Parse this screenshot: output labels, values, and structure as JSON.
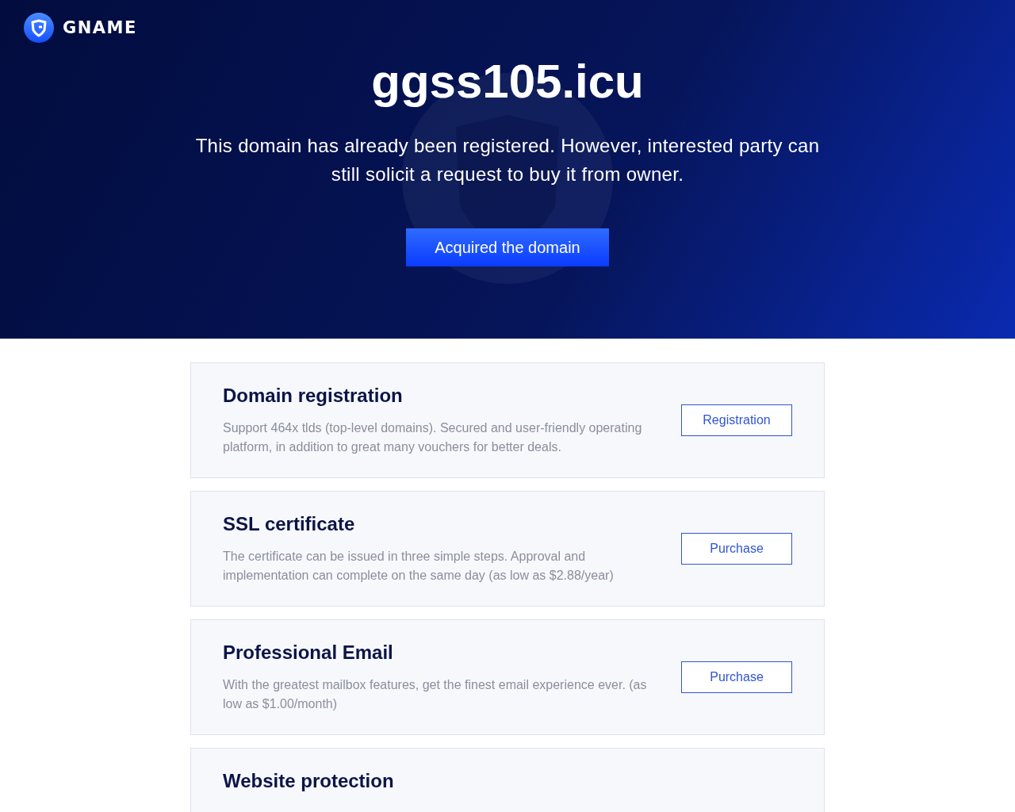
{
  "header": {
    "brand": "GNAME"
  },
  "hero": {
    "domain": "ggss105.icu",
    "message": "This domain has already been registered. However, interested party can still solicit a request to buy it from owner.",
    "button": "Acquired the domain"
  },
  "services": [
    {
      "title": "Domain registration",
      "description": "Support 464x tlds (top-level domains). Secured and user-friendly operating platform, in addition to great many vouchers for better deals.",
      "button": "Registration"
    },
    {
      "title": "SSL certificate",
      "description": "The certificate can be issued in three simple steps. Approval and implementation can complete on the same day (as low as $2.88/year)",
      "button": "Purchase"
    },
    {
      "title": "Professional Email",
      "description": "With the greatest mailbox features, get the finest email experience ever. (as low as $1.00/month)",
      "button": "Purchase"
    },
    {
      "title": "Website protection"
    }
  ]
}
